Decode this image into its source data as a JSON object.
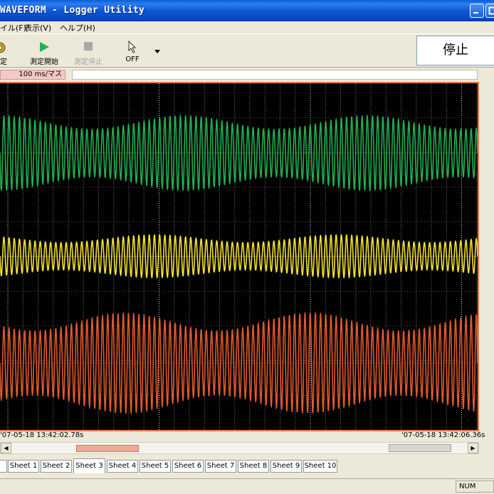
{
  "window": {
    "title": "WAVEFORM - Logger Utility"
  },
  "menu": [
    "ファイル(F)",
    "表示(V)",
    "ヘルプ(H)"
  ],
  "toolbar": {
    "settings_label": "設定",
    "start_label": "測定開始",
    "stop_label": "測定停止",
    "cursor_label": "OFF",
    "status_text": "停止"
  },
  "time": {
    "scale": "100 ms/マス",
    "start": "'07-05-18 13:42:02.78s",
    "end": "'07-05-18 13:42:06.36s"
  },
  "tabs": [
    "Sheet 1",
    "Sheet 2",
    "Sheet 3",
    "Sheet 4",
    "Sheet 5",
    "Sheet 6",
    "Sheet 7",
    "Sheet 8",
    "Sheet 9",
    "Sheet 10"
  ],
  "active_tab": "Sheet 3",
  "statusbar": {
    "num": "NUM"
  },
  "colors": {
    "channel1": "#20b050",
    "channel2": "#f3e12c",
    "channel3": "#e25a2c",
    "plot_border": "#e07a50",
    "title_bar": "#0a5fd6"
  },
  "chart_data": {
    "type": "line",
    "series": [
      {
        "color": "#20b050",
        "center": 213,
        "amplitude": 52,
        "cycles": 92
      },
      {
        "color": "#f3e12c",
        "center": 358,
        "amplitude": 30,
        "cycles": 92
      },
      {
        "color": "#e25a2c",
        "center": 508,
        "amplitude": 70,
        "cycles": 92
      }
    ],
    "grid": true
  }
}
